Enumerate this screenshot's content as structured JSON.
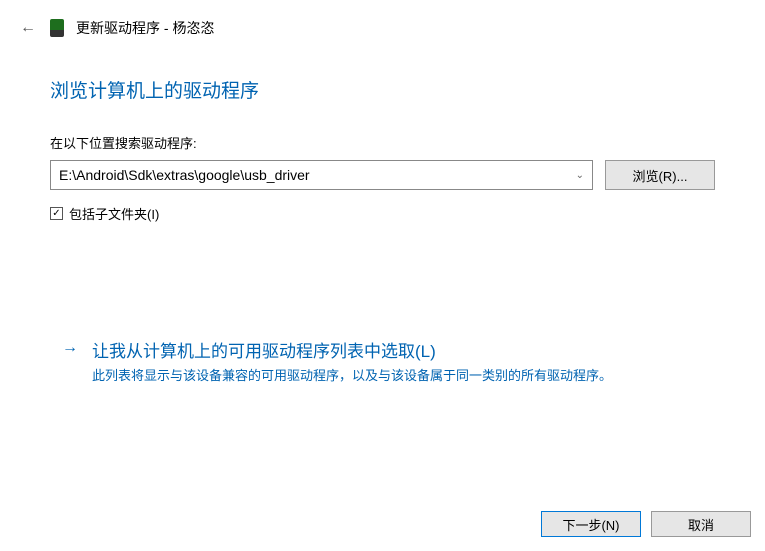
{
  "titlebar": {
    "title": "更新驱动程序 - 杨恣恣"
  },
  "heading": "浏览计算机上的驱动程序",
  "search": {
    "label": "在以下位置搜索驱动程序:",
    "path": "E:\\Android\\Sdk\\extras\\google\\usb_driver",
    "browse_label": "浏览(R)..."
  },
  "include_sub": {
    "checked": true,
    "label": "包括子文件夹(I)"
  },
  "option": {
    "title": "让我从计算机上的可用驱动程序列表中选取(L)",
    "desc": "此列表将显示与该设备兼容的可用驱动程序，以及与该设备属于同一类别的所有驱动程序。"
  },
  "footer": {
    "next": "下一步(N)",
    "cancel": "取消"
  }
}
